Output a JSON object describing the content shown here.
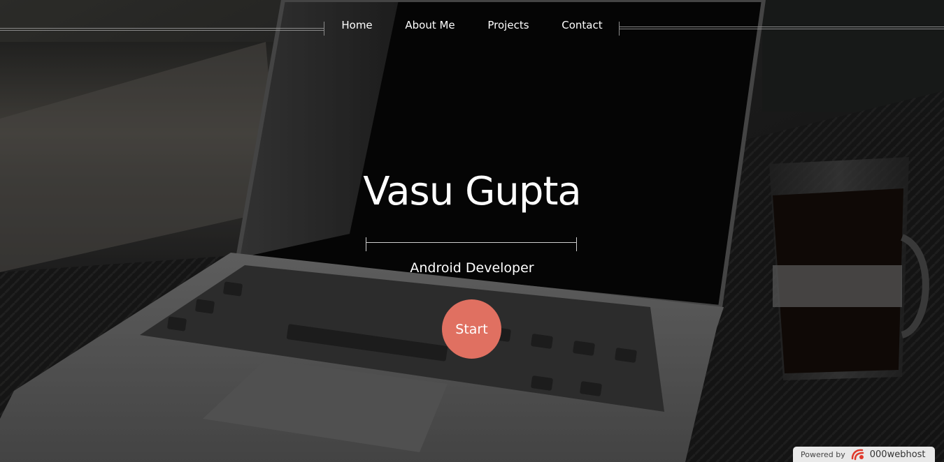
{
  "nav": {
    "items": [
      {
        "label": "Home"
      },
      {
        "label": "About Me"
      },
      {
        "label": "Projects"
      },
      {
        "label": "Contact"
      }
    ]
  },
  "hero": {
    "title": "Vasu Gupta",
    "subtitle": "Android Developer",
    "start_label": "Start"
  },
  "footer_badge": {
    "powered_text": "Powered by",
    "brand": "000webhost",
    "logo_icon": "000webhost-logo-icon"
  },
  "colors": {
    "accent": "#e07061",
    "overlay": "#000000",
    "text": "#ffffff"
  }
}
